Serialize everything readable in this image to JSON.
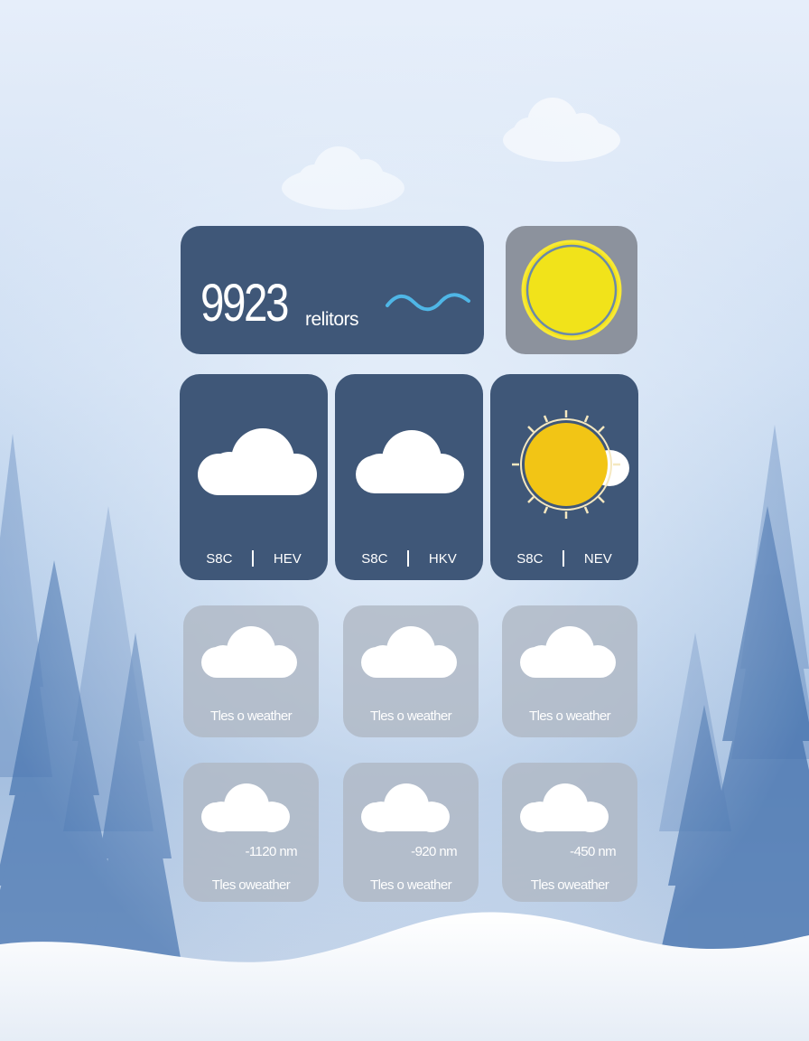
{
  "hero": {
    "value": "9923",
    "unit": "relitors",
    "wave_icon": "wave-icon",
    "sun_icon": "sun-icon"
  },
  "forecast": [
    {
      "icon": "cloud-icon",
      "left": "S8C",
      "right": "HEV"
    },
    {
      "icon": "cloud-icon",
      "left": "S8C",
      "right": "HKV"
    },
    {
      "icon": "sun-icon",
      "left": "S8C",
      "right": "NEV"
    }
  ],
  "row3": [
    {
      "icon": "cloud-icon",
      "caption": "Tles o weather"
    },
    {
      "icon": "cloud-icon",
      "caption": "Tles o weather"
    },
    {
      "icon": "cloud-icon",
      "caption": "Tles o weather"
    }
  ],
  "row4": [
    {
      "icon": "cloud-icon",
      "distance": "-1120 nm",
      "caption": "Tles oweather"
    },
    {
      "icon": "cloud-icon",
      "distance": "-920 nm",
      "caption": "Tles o weather"
    },
    {
      "icon": "cloud-icon",
      "distance": "-450 nm",
      "caption": "Tles oweather"
    }
  ],
  "colors": {
    "dark_tile": "#3f5778",
    "grey_tile": "#b0b8c4",
    "sun_yellow": "#f0d21a",
    "wave": "#4fb6e6"
  }
}
